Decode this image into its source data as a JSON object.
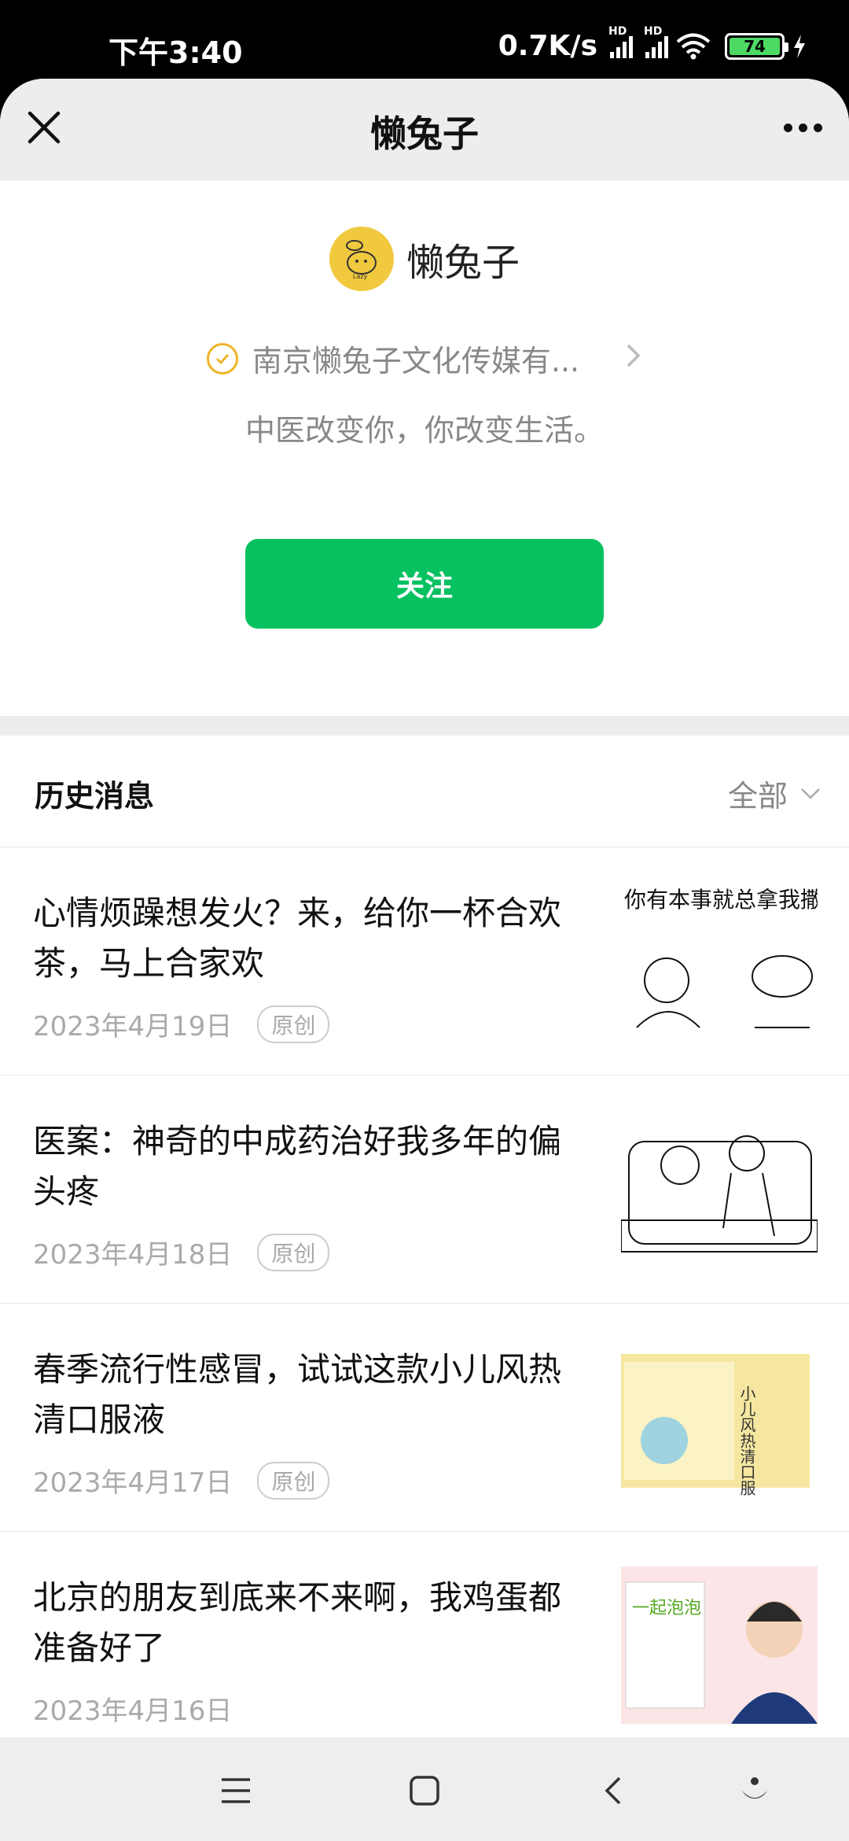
{
  "status": {
    "time": "下午3:40",
    "speed": "0.7K/s",
    "sig1_hd": "HD",
    "sig2_hd": "HD",
    "battery": "74"
  },
  "header": {
    "title": "懒兔子"
  },
  "profile": {
    "name": "懒兔子",
    "company": "南京懒兔子文化传媒有...",
    "description": "中医改变你，你改变生活。",
    "follow_label": "关注",
    "avatar_text": "Lazy"
  },
  "history": {
    "label": "历史消息",
    "filter_label": "全部",
    "items": [
      {
        "title": "心情烦躁想发火？来，给你一杯合欢茶，马上合家欢",
        "date": "2023年4月19日",
        "badge": "原创",
        "thumb_text": "你有本事就总拿我撒气"
      },
      {
        "title": "医案：神奇的中成药治好我多年的偏头疼",
        "date": "2023年4月18日",
        "badge": "原创"
      },
      {
        "title": "春季流行性感冒，试试这款小儿风热清口服液",
        "date": "2023年4月17日",
        "badge": "原创",
        "thumb_text": "小儿风热清口服液"
      },
      {
        "title": "北京的朋友到底来不来啊，我鸡蛋都准备好了",
        "date": "2023年4月16日",
        "badge": "",
        "thumb_text": "一起泡泡"
      }
    ]
  },
  "colors": {
    "accent": "#07c160",
    "verify": "#f0b429",
    "avatar": "#f0c93e"
  }
}
